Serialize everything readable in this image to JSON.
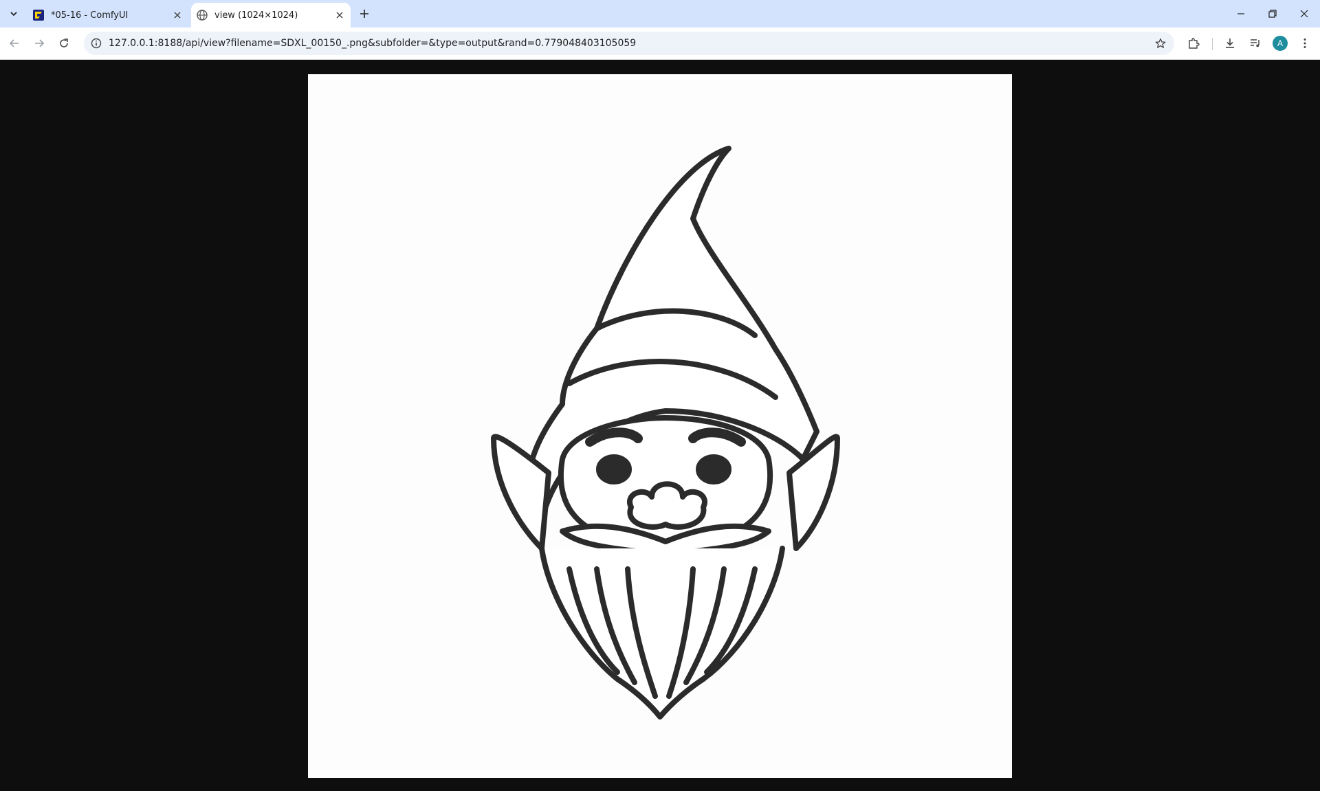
{
  "tabs": [
    {
      "title": "*05-16 - ComfyUI",
      "active": false,
      "icon": "comfyui-icon"
    },
    {
      "title": "view (1024×1024)",
      "active": true,
      "icon": "globe-icon"
    }
  ],
  "address_bar": {
    "url": "127.0.0.1:8188/api/view?filename=SDXL_00150_.png&subfolder=&type=output&rand=0.779048403105059"
  },
  "profile": {
    "initial": "A",
    "color": "#1e8e9e"
  },
  "image": {
    "description_icon": "gnome-line-art",
    "natural_width": 1024,
    "natural_height": 1024
  },
  "colors": {
    "tabbar": "#d3e3fd",
    "viewer_bg": "#0e0e0e",
    "accent": "#1e8e9e"
  }
}
